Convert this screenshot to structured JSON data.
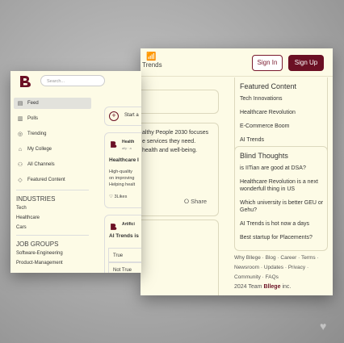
{
  "right_window": {
    "nav": {
      "trends_label": "Trends",
      "trends_icon": "chart-icon"
    },
    "auth": {
      "signin_label": "Sign In",
      "signup_label": "Sign Up"
    },
    "post_fragment": {
      "text_lines": [
        "althy People 2030 focuses",
        "e services they need.",
        "health and well-being."
      ],
      "share_label": "Share"
    },
    "featured_content": {
      "title": "Featured Content",
      "items": [
        "Tech Innovations",
        "Healthcare Revolution",
        "E-Commerce Boom",
        "AI Trends"
      ]
    },
    "blind_thoughts": {
      "title": "Blind Thoughts",
      "items": [
        "is IITian are good at DSA?",
        "Healthcare Revolution is a next wonderfull thing in US",
        "Which university is better GEU or Gehu?",
        "AI Trends is hot now a days",
        "Best startup for Placements?"
      ]
    },
    "footer": {
      "links_line1": "Why Bllege · Blog · Career · Terms ·",
      "links_line2": "Newsroom · Updates · Privacy ·",
      "links_line3": "Community · FAQs",
      "copyright_prefix": "2024 Team",
      "brand": "Bllege",
      "copyright_suffix": "inc."
    }
  },
  "left_window": {
    "search": {
      "placeholder": "Search..."
    },
    "sidebar": {
      "items": [
        {
          "label": "Feed",
          "icon": "feed-icon"
        },
        {
          "label": "Polls",
          "icon": "polls-icon"
        },
        {
          "label": "Trending",
          "icon": "trending-icon"
        },
        {
          "label": "My College",
          "icon": "college-icon"
        },
        {
          "label": "All Channels",
          "icon": "channels-icon"
        },
        {
          "label": "Featured Content",
          "icon": "featured-icon"
        }
      ],
      "industries": {
        "title": "INDUSTRIES",
        "items": [
          "Tech",
          "Healthcare",
          "Cars"
        ]
      },
      "job_groups": {
        "title": "JOB GROUPS",
        "items": [
          "Software-Engineering",
          "Product-Management"
        ]
      }
    },
    "composer": {
      "label": "Start a"
    },
    "post1": {
      "author": "Health",
      "meta": "ally · a",
      "title": "Healthcare I",
      "body": [
        "High-quality",
        "on improving",
        "Helping healt"
      ],
      "likes": "3Likes"
    },
    "post2": {
      "author": "Artifici",
      "title": "AI Trends is",
      "options": [
        "True",
        "Not True"
      ]
    }
  },
  "colors": {
    "brand": "#6b1024",
    "background": "#fdfbe6"
  }
}
